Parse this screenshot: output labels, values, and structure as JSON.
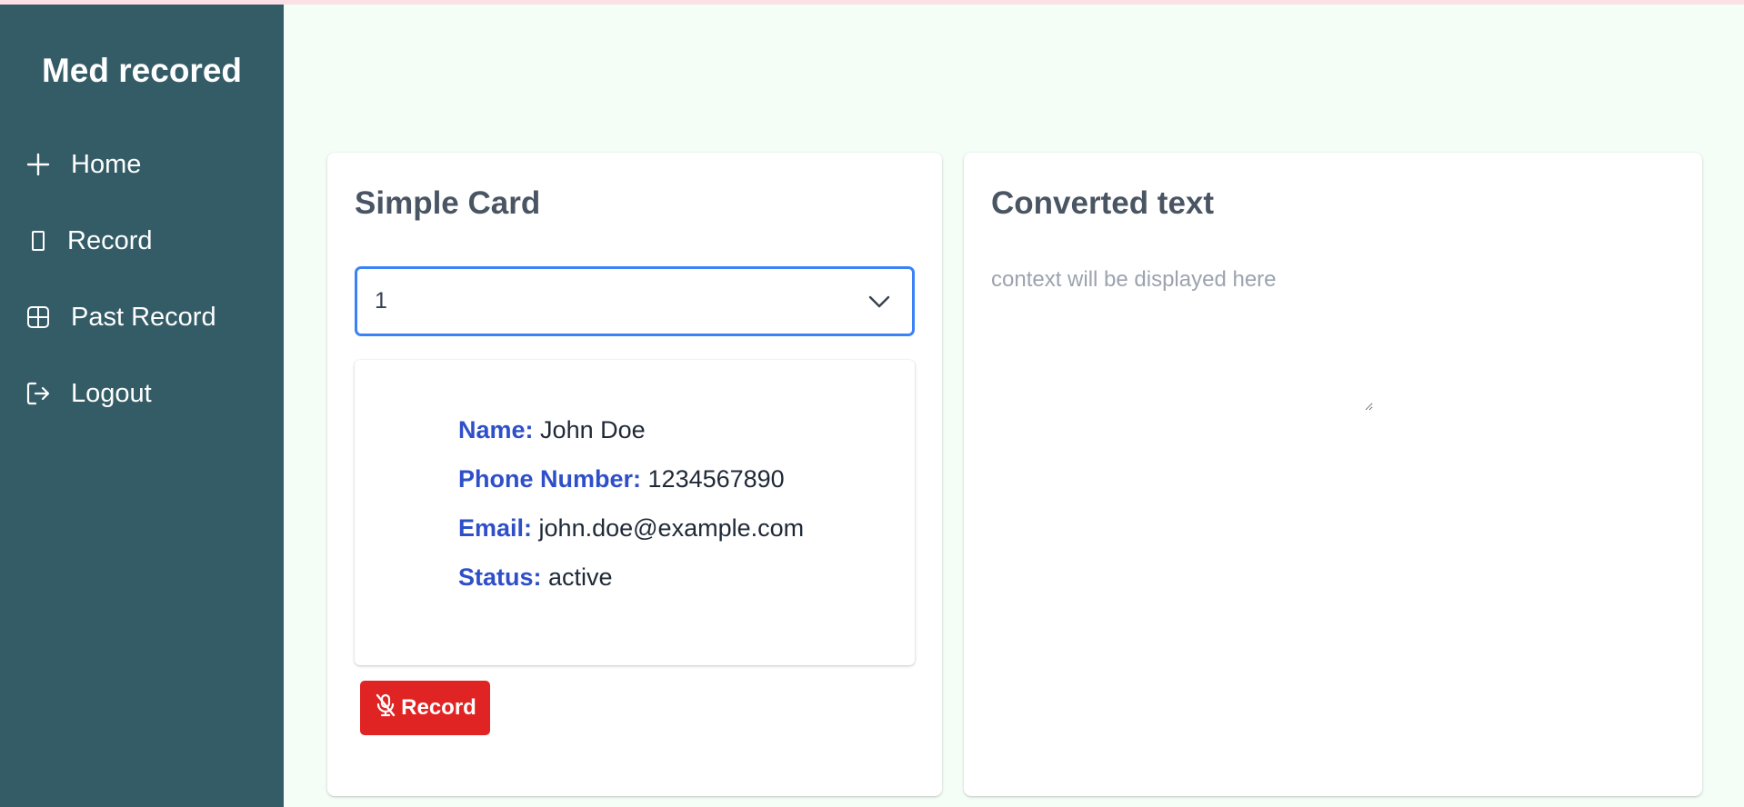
{
  "app": {
    "brand": "Med recored"
  },
  "sidebar": {
    "items": [
      {
        "label": "Home",
        "icon": "plus-icon"
      },
      {
        "label": "Record",
        "icon": "rectangle-icon"
      },
      {
        "label": "Past Record",
        "icon": "grid-icon"
      },
      {
        "label": "Logout",
        "icon": "logout-icon"
      }
    ]
  },
  "left_card": {
    "title": "Simple Card",
    "select": {
      "value": "1"
    },
    "patient": {
      "name_label": "Name:",
      "name_value": "John Doe",
      "phone_label": "Phone Number:",
      "phone_value": "1234567890",
      "email_label": "Email:",
      "email_value": "john.doe@example.com",
      "status_label": "Status:",
      "status_value": "active"
    },
    "record_button": "Record"
  },
  "right_card": {
    "title": "Converted text",
    "placeholder": "context will be displayed here"
  },
  "colors": {
    "sidebar_bg": "#345c66",
    "page_bg": "#f4fdf6",
    "accent_blue": "#3b82f6",
    "label_blue": "#2f4fc9",
    "record_red": "#e02424"
  }
}
